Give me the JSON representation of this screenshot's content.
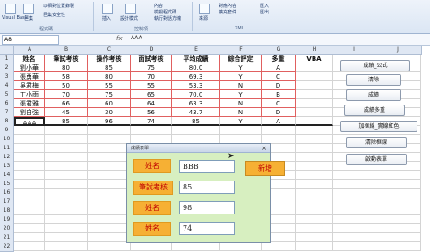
{
  "ribbon": {
    "visual_basic": "Visual Basic",
    "macros": "巨集",
    "use_relative": "以相對位置錄製",
    "macro_security": "巨集安全性",
    "group_code": "程式碼",
    "insert": "插入",
    "design_mode": "設計模式",
    "properties": "內容",
    "view_code": "檢視程式碼",
    "run_dialog": "執行對話方塊",
    "group_controls": "控制項",
    "source": "來源",
    "map_props": "對應內容",
    "expansion": "擴充套件",
    "import": "匯入",
    "export": "匯出",
    "group_xml": "XML"
  },
  "formula_bar": {
    "name_box": "A8",
    "fx": "fx",
    "value": "AAA"
  },
  "columns": [
    "A",
    "B",
    "C",
    "D",
    "E",
    "F",
    "G",
    "H",
    "I",
    "J"
  ],
  "rows": [
    {
      "n": "1",
      "cells": [
        "姓名",
        "筆試考核",
        "操作考核",
        "面試考核",
        "平均成績",
        "綜合評定",
        "多重",
        "VBA"
      ]
    },
    {
      "n": "2",
      "cells": [
        "劉小華",
        "80",
        "85",
        "75",
        "80.0",
        "Y",
        "A",
        ""
      ]
    },
    {
      "n": "3",
      "cells": [
        "張勇華",
        "58",
        "80",
        "70",
        "69.3",
        "Y",
        "C",
        ""
      ]
    },
    {
      "n": "4",
      "cells": [
        "吳君梅",
        "50",
        "55",
        "55",
        "53.3",
        "N",
        "D",
        ""
      ]
    },
    {
      "n": "5",
      "cells": [
        "丁小雨",
        "70",
        "75",
        "65",
        "70.0",
        "Y",
        "B",
        ""
      ]
    },
    {
      "n": "6",
      "cells": [
        "張君雅",
        "66",
        "60",
        "64",
        "63.3",
        "N",
        "C",
        ""
      ]
    },
    {
      "n": "7",
      "cells": [
        "劉自強",
        "45",
        "30",
        "56",
        "43.7",
        "N",
        "D",
        ""
      ]
    },
    {
      "n": "8",
      "cells": [
        "AAA",
        "85",
        "96",
        "74",
        "85",
        "Y",
        "A",
        ""
      ]
    },
    {
      "n": "9",
      "cells": [
        "",
        "",
        "",
        "",
        "",
        "",
        "",
        ""
      ]
    },
    {
      "n": "10",
      "cells": [
        "",
        "",
        "",
        "",
        "",
        "",
        "",
        ""
      ]
    },
    {
      "n": "11",
      "cells": [
        "",
        "",
        "",
        "",
        "",
        "",
        "",
        ""
      ]
    },
    {
      "n": "12",
      "cells": [
        "",
        "",
        "",
        "",
        "",
        "",
        "",
        ""
      ]
    },
    {
      "n": "13",
      "cells": [
        "",
        "",
        "",
        "",
        "",
        "",
        "",
        ""
      ]
    },
    {
      "n": "14",
      "cells": [
        "",
        "",
        "",
        "",
        "",
        "",
        "",
        ""
      ]
    },
    {
      "n": "15",
      "cells": [
        "",
        "",
        "",
        "",
        "",
        "",
        "",
        ""
      ]
    },
    {
      "n": "16",
      "cells": [
        "",
        "",
        "",
        "",
        "",
        "",
        "",
        ""
      ]
    },
    {
      "n": "17",
      "cells": [
        "",
        "",
        "",
        "",
        "",
        "",
        "",
        ""
      ]
    },
    {
      "n": "18",
      "cells": [
        "",
        "",
        "",
        "",
        "",
        "",
        "",
        ""
      ]
    },
    {
      "n": "19",
      "cells": [
        "",
        "",
        "",
        "",
        "",
        "",
        "",
        ""
      ]
    },
    {
      "n": "20",
      "cells": [
        "",
        "",
        "",
        "",
        "",
        "",
        "",
        ""
      ]
    },
    {
      "n": "21",
      "cells": [
        "",
        "",
        "",
        "",
        "",
        "",
        "",
        ""
      ]
    },
    {
      "n": "22",
      "cells": [
        "",
        "",
        "",
        "",
        "",
        "",
        "",
        ""
      ]
    }
  ],
  "sheet_buttons": [
    "成績_公式",
    "清除",
    "成績",
    "成績多重",
    "加框線_實線紅色",
    "清除框線",
    "啟動表單"
  ],
  "form": {
    "title": "成績表單",
    "close": "×",
    "labels": [
      "姓名",
      "筆試考核",
      "姓名",
      "姓名"
    ],
    "values": [
      "BBB",
      "85",
      "98",
      "74"
    ],
    "add_button": "新增"
  },
  "colors": {
    "form_bg": "#d7efc0",
    "label_bg": "#f6b034",
    "label_text": "#c00000"
  }
}
